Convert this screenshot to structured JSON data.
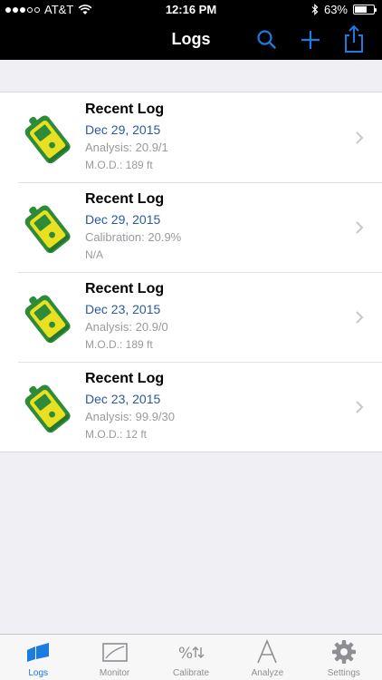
{
  "status_bar": {
    "carrier": "AT&T",
    "time": "12:16 PM",
    "battery": "63%",
    "battery_level": 0.63
  },
  "nav": {
    "title": "Logs",
    "buttons": [
      "search-icon",
      "add-icon",
      "share-icon"
    ]
  },
  "colors": {
    "accent": "#1b7be0",
    "date_text": "#2a5a9c",
    "nav_background": "#000000",
    "device_green": "#2e8b3a",
    "device_yellow": "#e8e020"
  },
  "logs": [
    {
      "title": "Recent Log",
      "date": "Dec 29, 2015",
      "detail": "Analysis: 20.9/1",
      "mod": "M.O.D.: 189 ft"
    },
    {
      "title": "Recent Log",
      "date": "Dec 29, 2015",
      "detail": "Calibration: 20.9%",
      "mod": "N/A"
    },
    {
      "title": "Recent Log",
      "date": "Dec 23, 2015",
      "detail": "Analysis: 20.9/0",
      "mod": "M.O.D.: 189 ft"
    },
    {
      "title": "Recent Log",
      "date": "Dec 23, 2015",
      "detail": "Analysis: 99.9/30",
      "mod": "M.O.D.: 12 ft"
    }
  ],
  "tabs": [
    {
      "label": "Logs",
      "icon": "logs-icon",
      "active": true
    },
    {
      "label": "Monitor",
      "icon": "monitor-icon",
      "active": false
    },
    {
      "label": "Calibrate",
      "icon": "calibrate-icon",
      "active": false
    },
    {
      "label": "Analyze",
      "icon": "analyze-icon",
      "active": false
    },
    {
      "label": "Settings",
      "icon": "gear-icon",
      "active": false
    }
  ]
}
